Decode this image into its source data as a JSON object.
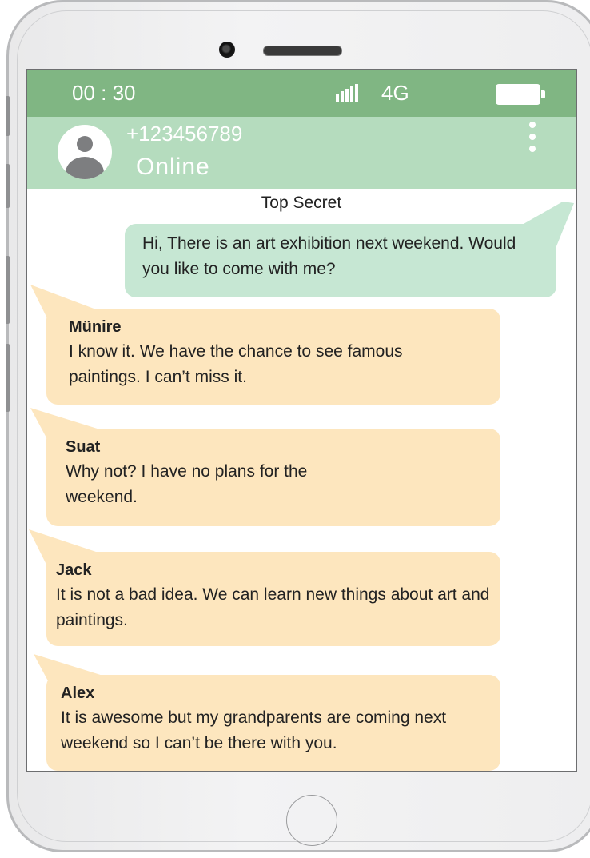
{
  "status_bar": {
    "time": "00 : 30",
    "network": "4G",
    "signal_bars": 5
  },
  "contact": {
    "number": "+123456789",
    "presence": "Online"
  },
  "chat": {
    "title": "Top Secret",
    "messages": [
      {
        "type": "outgoing",
        "text": "Hi, There is an art exhibition next weekend. Would you like to come with me?"
      },
      {
        "type": "incoming",
        "sender": "Münire",
        "text": "I know it. We have the chance to see famous paintings. I can’t miss it."
      },
      {
        "type": "incoming",
        "sender": "Suat",
        "text": "Why not? I have no plans for the weekend."
      },
      {
        "type": "incoming",
        "sender": "Jack",
        "text": "It is not a bad idea. We can learn new things about art and paintings."
      },
      {
        "type": "incoming",
        "sender": "Alex",
        "text": "It is awesome but my grandparents are coming next weekend so I can’t be there with you."
      }
    ]
  },
  "colors": {
    "status_bar": "#80b683",
    "contact_bar": "#b5dcbe",
    "outgoing_bubble": "#c6e7d3",
    "incoming_bubble": "#fde6be"
  }
}
